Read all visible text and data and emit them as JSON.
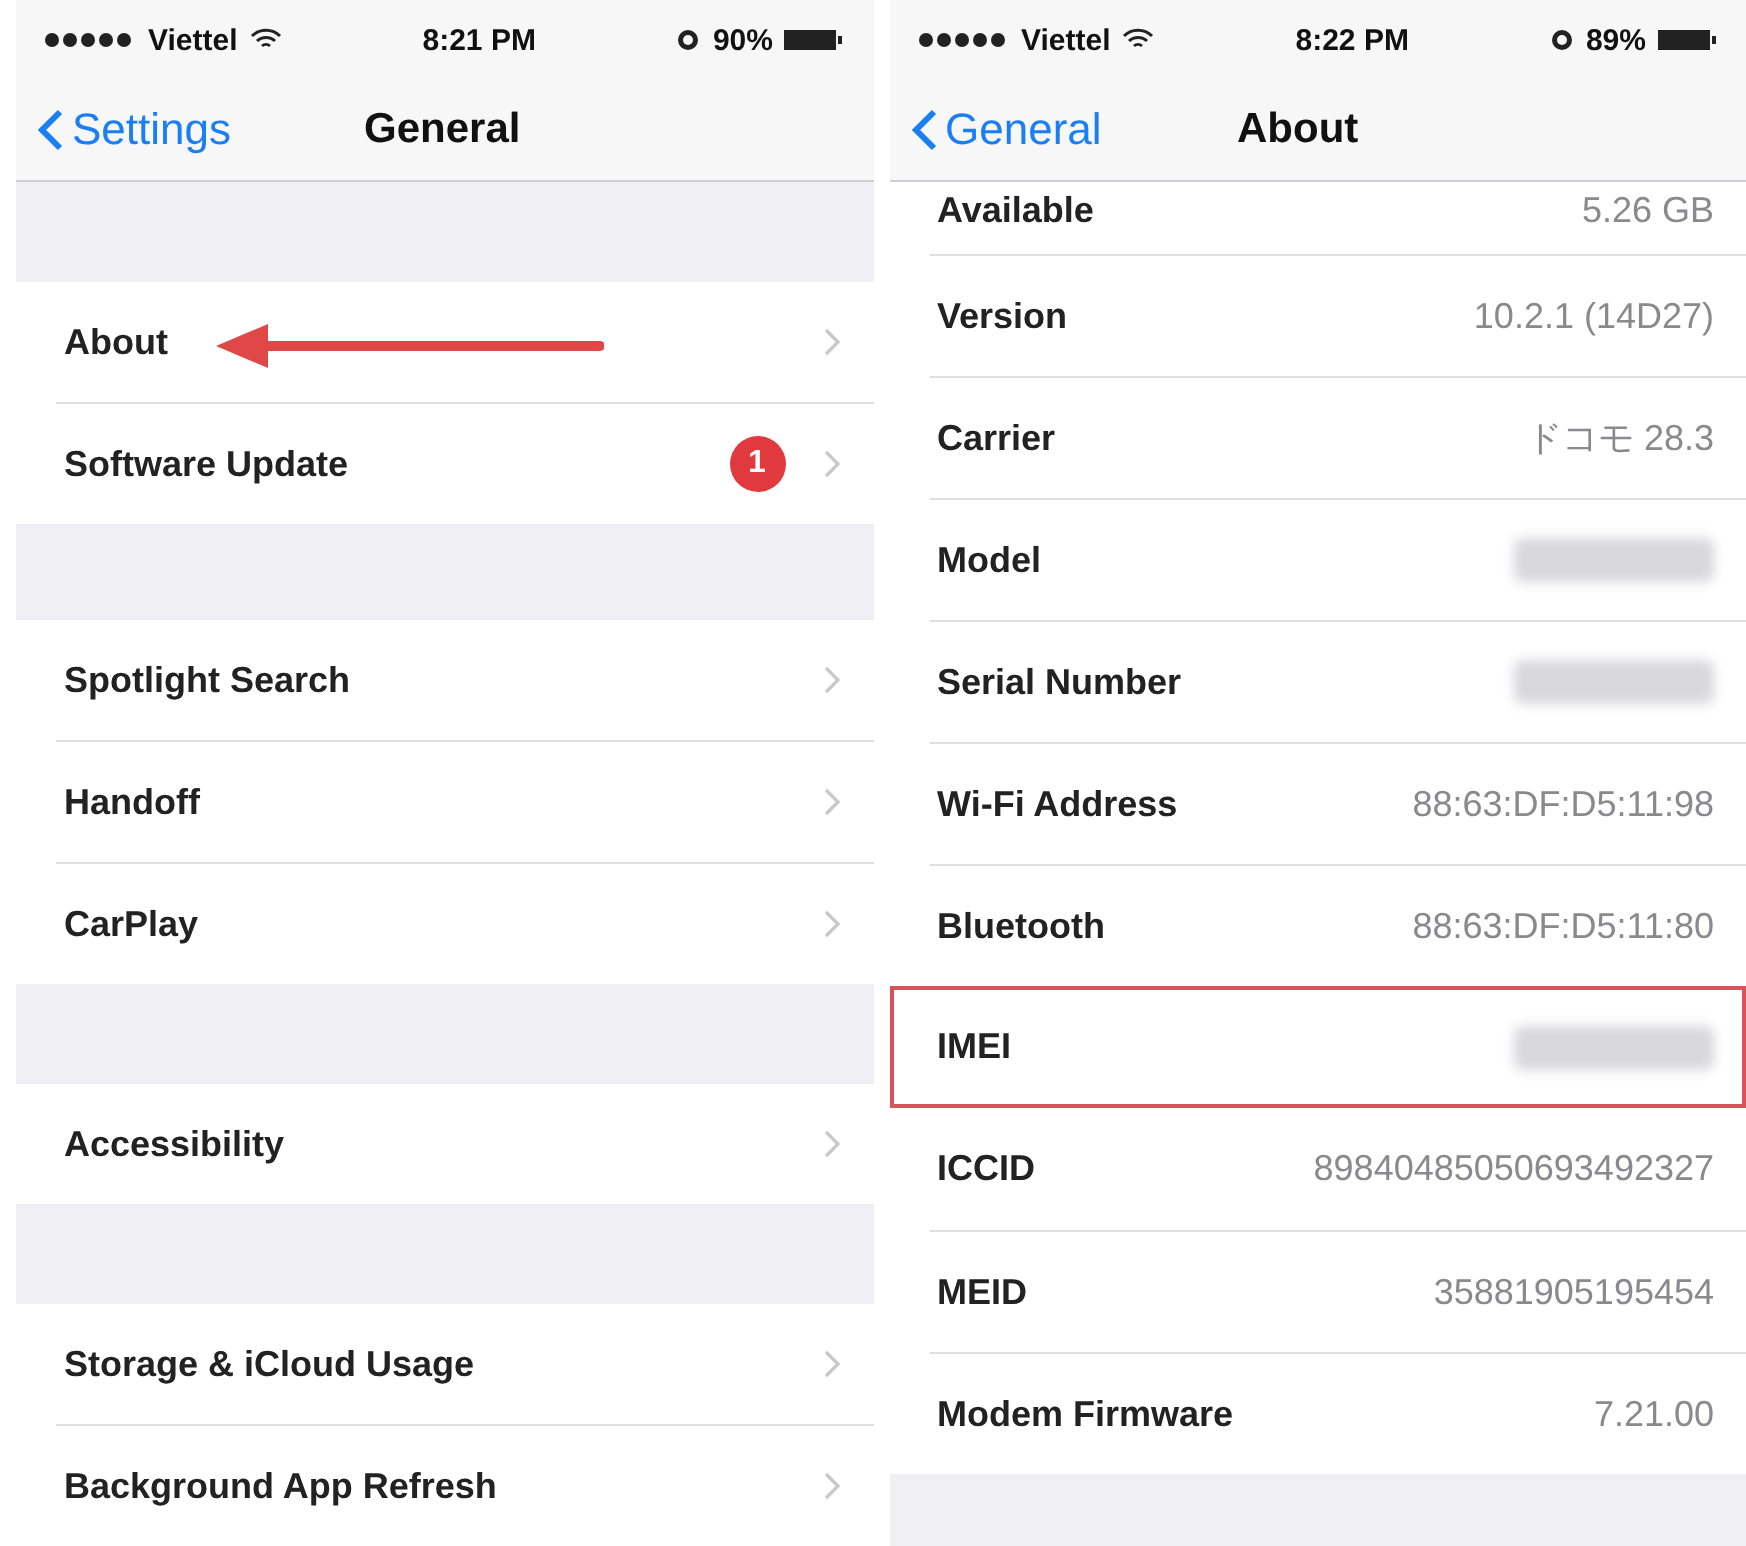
{
  "screens": [
    {
      "status_bar": {
        "carrier": "Viettel",
        "time": "8:21 PM",
        "battery": "90%"
      },
      "nav": {
        "back": "Settings",
        "title": "General"
      },
      "groups": [
        [
          {
            "label": "About",
            "annotated": true
          },
          {
            "label": "Software Update",
            "badge": "1"
          }
        ],
        [
          {
            "label": "Spotlight Search"
          },
          {
            "label": "Handoff"
          },
          {
            "label": "CarPlay"
          }
        ],
        [
          {
            "label": "Accessibility"
          }
        ],
        [
          {
            "label": "Storage & iCloud Usage"
          },
          {
            "label": "Background App Refresh"
          }
        ]
      ]
    },
    {
      "status_bar": {
        "carrier": "Viettel",
        "time": "8:22 PM",
        "battery": "89%"
      },
      "nav": {
        "back": "General",
        "title": "About"
      },
      "rows": [
        {
          "label": "Available",
          "value": "5.26 GB",
          "kind": "text",
          "highlighted": false
        },
        {
          "label": "Version",
          "value": "10.2.1 (14D27)",
          "kind": "text",
          "highlighted": false
        },
        {
          "label": "Carrier",
          "value": "ドコモ 28.3",
          "kind": "text",
          "highlighted": false
        },
        {
          "label": "Model",
          "kind": "blurred",
          "highlighted": false
        },
        {
          "label": "Serial Number",
          "kind": "blurred",
          "highlighted": false
        },
        {
          "label": "Wi-Fi Address",
          "value": "88:63:DF:D5:11:98",
          "kind": "text",
          "highlighted": false
        },
        {
          "label": "Bluetooth",
          "value": "88:63:DF:D5:11:80",
          "kind": "text",
          "highlighted": false
        },
        {
          "label": "IMEI",
          "kind": "blurred",
          "highlighted": true
        },
        {
          "label": "ICCID",
          "value": "89840485050693492327",
          "kind": "text",
          "highlighted": false
        },
        {
          "label": "MEID",
          "value": "35881905195454",
          "kind": "text",
          "highlighted": false
        },
        {
          "label": "Modem Firmware",
          "value": "7.21.00",
          "kind": "text",
          "highlighted": false
        }
      ]
    }
  ]
}
